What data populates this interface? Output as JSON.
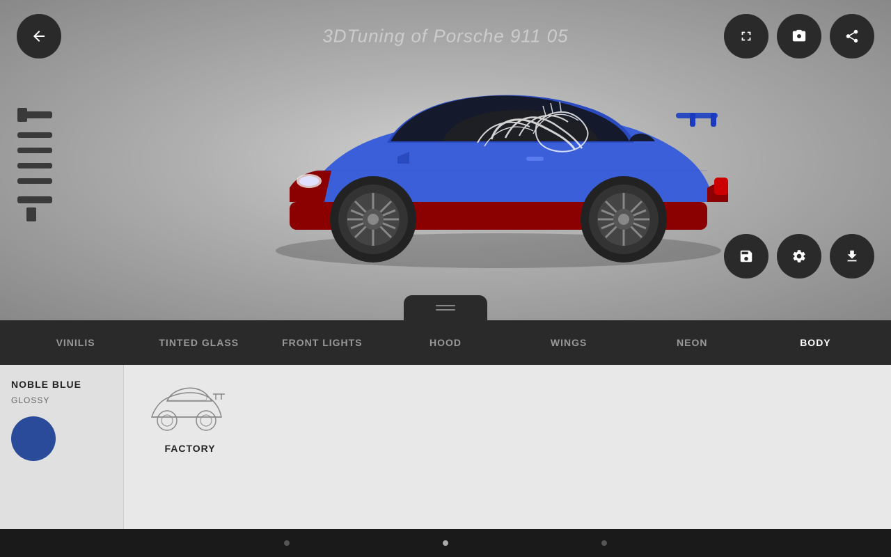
{
  "header": {
    "title": "3DTuning of Porsche 911 05"
  },
  "toolbar_top": {
    "back_label": "←",
    "fullscreen_label": "⛶",
    "camera_label": "📷",
    "share_label": "↗"
  },
  "toolbar_bottom_viewer": {
    "save_label": "💾",
    "settings_label": "⚙",
    "download_label": "⬇"
  },
  "nav_tabs": [
    {
      "id": "vinilis",
      "label": "VINILIS",
      "active": false
    },
    {
      "id": "tinted_glass",
      "label": "TINTED GLASS",
      "active": false
    },
    {
      "id": "front_lights",
      "label": "FRONT LIGHTS",
      "active": false
    },
    {
      "id": "hood",
      "label": "HOOD",
      "active": false
    },
    {
      "id": "wings",
      "label": "WINGS",
      "active": false
    },
    {
      "id": "neon",
      "label": "NEON",
      "active": false
    },
    {
      "id": "body",
      "label": "BODY",
      "active": true
    }
  ],
  "color_panel": {
    "name": "NOBLE BLUE",
    "type": "GLOSSY",
    "swatch_color": "#2a4a9a"
  },
  "options": [
    {
      "id": "factory",
      "label": "FACTORY"
    }
  ],
  "dots": [
    {
      "active": false
    },
    {
      "active": true
    },
    {
      "active": false
    }
  ]
}
